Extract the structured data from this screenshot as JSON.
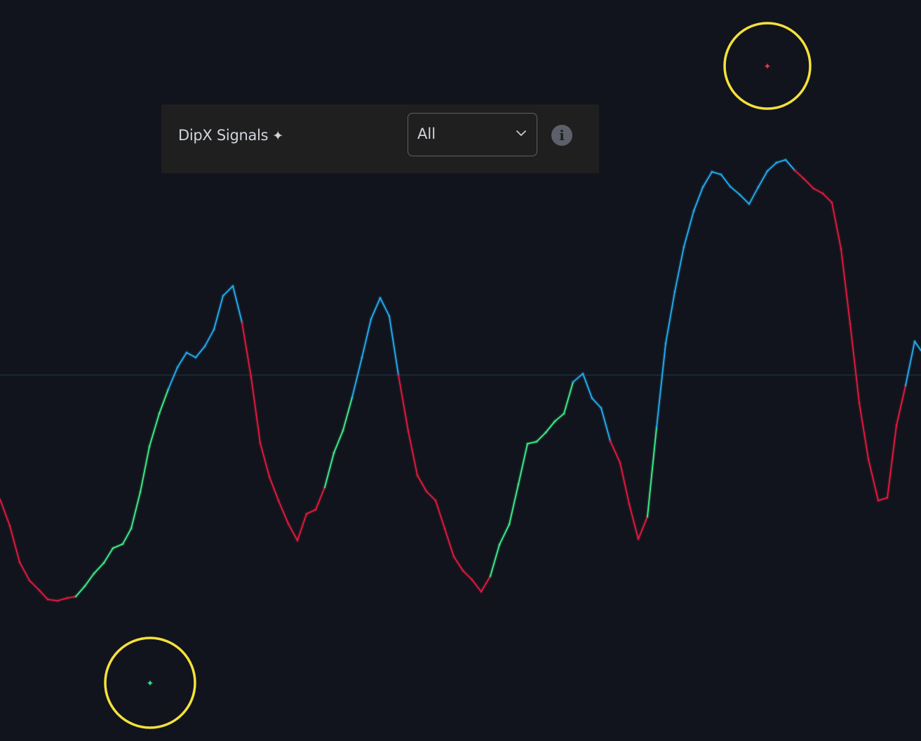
{
  "panel": {
    "label": "DipX Signals",
    "star_glyph": "✦",
    "dropdown": {
      "selected": "All",
      "icon": "chevron-down-icon"
    },
    "info_icon": "info-icon",
    "info_glyph": "i"
  },
  "colors": {
    "background": "#11141d",
    "panel_bg": "#1f1f1f",
    "bearish": "#e5193e",
    "bullish": "#3ff08a",
    "strong": "#23aef2",
    "zero_line": "#1e3a48",
    "highlight_ring": "#f5e13a",
    "signal_buy": "#2fe08a",
    "signal_sell": "#f0314e"
  },
  "chart_data": {
    "type": "line",
    "series": [
      {
        "points": [
          [
            0,
            712,
            "bear"
          ],
          [
            14,
            750,
            "bear"
          ],
          [
            28,
            802,
            "bear"
          ],
          [
            42,
            828,
            "bear"
          ],
          [
            56,
            842,
            "bear"
          ],
          [
            68,
            855,
            "bear"
          ],
          [
            82,
            857,
            "bear"
          ],
          [
            96,
            853,
            "bear"
          ],
          [
            108,
            851,
            "bull"
          ],
          [
            121,
            836,
            "bull"
          ],
          [
            134,
            818,
            "bull"
          ],
          [
            148,
            803,
            "bull"
          ],
          [
            161,
            782,
            "bull"
          ],
          [
            175,
            776,
            "bull"
          ],
          [
            187,
            754,
            "bull"
          ],
          [
            200,
            702,
            "bull"
          ],
          [
            213,
            637,
            "bull"
          ],
          [
            227,
            590,
            "bull"
          ],
          [
            240,
            555,
            "strong"
          ],
          [
            253,
            524,
            "strong"
          ],
          [
            266,
            503,
            "strong"
          ],
          [
            279,
            510,
            "strong"
          ],
          [
            292,
            494,
            "strong"
          ],
          [
            305,
            470,
            "strong"
          ],
          [
            318,
            422,
            "strong"
          ],
          [
            332,
            408,
            "strong"
          ],
          [
            345,
            460,
            "bear"
          ],
          [
            358,
            538,
            "bear"
          ],
          [
            371,
            632,
            "bear"
          ],
          [
            384,
            680,
            "bear"
          ],
          [
            397,
            714,
            "bear"
          ],
          [
            411,
            747,
            "bear"
          ],
          [
            424,
            771,
            "bear"
          ],
          [
            437,
            733,
            "bear"
          ],
          [
            450,
            727,
            "bear"
          ],
          [
            463,
            695,
            "bull"
          ],
          [
            476,
            646,
            "bull"
          ],
          [
            489,
            614,
            "bull"
          ],
          [
            502,
            567,
            "strong"
          ],
          [
            516,
            510,
            "strong"
          ],
          [
            529,
            455,
            "strong"
          ],
          [
            542,
            425,
            "strong"
          ],
          [
            555,
            451,
            "strong"
          ],
          [
            568,
            535,
            "bear"
          ],
          [
            582,
            615,
            "bear"
          ],
          [
            595,
            678,
            "bear"
          ],
          [
            608,
            701,
            "bear"
          ],
          [
            621,
            714,
            "bear"
          ],
          [
            634,
            754,
            "bear"
          ],
          [
            647,
            794,
            "bear"
          ],
          [
            660,
            814,
            "bear"
          ],
          [
            673,
            827,
            "bear"
          ],
          [
            686,
            844,
            "bear"
          ],
          [
            699,
            822,
            "bull"
          ],
          [
            712,
            777,
            "bull"
          ],
          [
            726,
            748,
            "bull"
          ],
          [
            739,
            691,
            "bull"
          ],
          [
            752,
            633,
            "bull"
          ],
          [
            765,
            630,
            "bull"
          ],
          [
            778,
            617,
            "bull"
          ],
          [
            791,
            601,
            "bull"
          ],
          [
            804,
            590,
            "bull"
          ],
          [
            817,
            545,
            "strong"
          ],
          [
            831,
            533,
            "strong"
          ],
          [
            844,
            568,
            "strong"
          ],
          [
            857,
            582,
            "strong"
          ],
          [
            870,
            629,
            "bear"
          ],
          [
            884,
            660,
            "bear"
          ],
          [
            897,
            719,
            "bear"
          ],
          [
            910,
            769,
            "bear"
          ],
          [
            923,
            737,
            "bull"
          ],
          [
            936,
            610,
            "strong"
          ],
          [
            949,
            490,
            "strong"
          ],
          [
            962,
            416,
            "strong"
          ],
          [
            975,
            352,
            "strong"
          ],
          [
            989,
            301,
            "strong"
          ],
          [
            1002,
            267,
            "strong"
          ],
          [
            1015,
            245,
            "strong"
          ],
          [
            1028,
            249,
            "strong"
          ],
          [
            1041,
            266,
            "strong"
          ],
          [
            1055,
            278,
            "strong"
          ],
          [
            1068,
            291,
            "strong"
          ],
          [
            1081,
            267,
            "strong"
          ],
          [
            1094,
            244,
            "strong"
          ],
          [
            1107,
            232,
            "strong"
          ],
          [
            1120,
            228,
            "strong"
          ],
          [
            1133,
            243,
            "bear"
          ],
          [
            1146,
            255,
            "bear"
          ],
          [
            1160,
            269,
            "bear"
          ],
          [
            1173,
            276,
            "bear"
          ],
          [
            1186,
            289,
            "bear"
          ],
          [
            1199,
            355,
            "bear"
          ],
          [
            1212,
            462,
            "bear"
          ],
          [
            1225,
            575,
            "bear"
          ],
          [
            1238,
            655,
            "bear"
          ],
          [
            1252,
            714,
            "bear"
          ],
          [
            1265,
            710,
            "bear"
          ],
          [
            1278,
            607,
            "bear"
          ],
          [
            1291,
            550,
            "strong"
          ],
          [
            1304,
            487,
            "strong"
          ],
          [
            1313,
            500,
            "bear"
          ]
        ]
      }
    ],
    "zero_line_y": 535,
    "markers": [
      {
        "cx": 1094,
        "cy": 94,
        "r": 61,
        "kind": "sell",
        "glyph": "✦"
      },
      {
        "cx": 214,
        "cy": 974,
        "r": 64,
        "kind": "buy",
        "glyph": "✦"
      }
    ]
  }
}
